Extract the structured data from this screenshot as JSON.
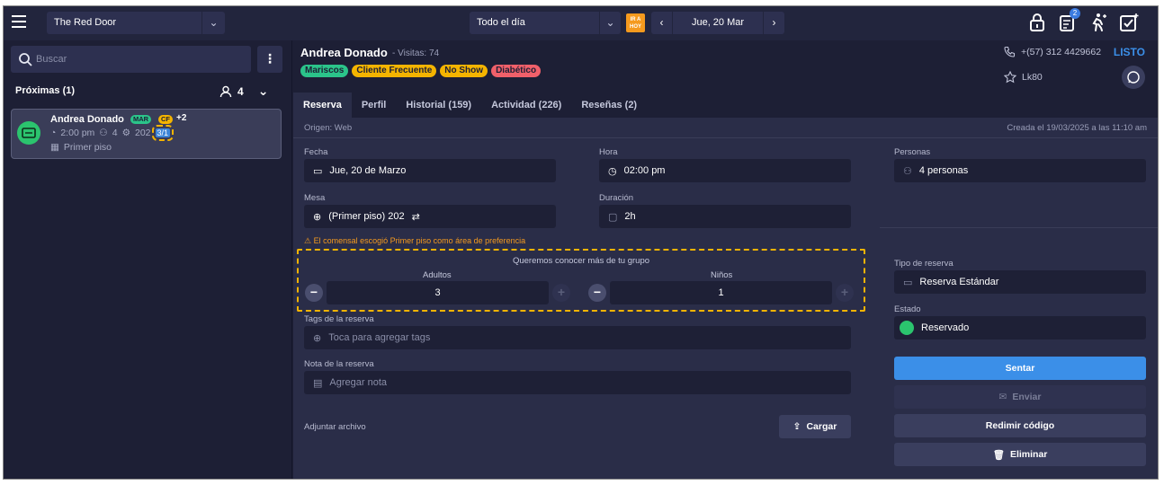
{
  "topbar": {
    "venue": "The Red Door",
    "shift": "Todo el día",
    "go_today": "IR A HOY",
    "date": "Jue, 20 Mar",
    "notification_count": "2"
  },
  "sidebar": {
    "search_placeholder": "Buscar",
    "section_title": "Próximas (1)",
    "section_covers": "4",
    "reservation": {
      "name": "Andrea Donado",
      "tag1": "MAR",
      "tag2": "CF",
      "more_tags": "+2",
      "time": "2:00 pm",
      "covers": "4",
      "table": "202",
      "count": "3/1",
      "area": "Primer piso"
    }
  },
  "guest": {
    "name": "Andrea Donado",
    "visits": "- Visitas: 74",
    "tags": [
      {
        "label": "Mariscos",
        "color": "#2bc48a"
      },
      {
        "label": "Cliente Frecuente",
        "color": "#f4b400"
      },
      {
        "label": "No Show",
        "color": "#f4b400"
      },
      {
        "label": "Diabético",
        "color": "#f0606a"
      }
    ],
    "phone": "+(57) 312 4429662",
    "status": "LISTO",
    "loyalty": "Lk80"
  },
  "tabs": [
    "Reserva",
    "Perfil",
    "Historial (159)",
    "Actividad (226)",
    "Reseñas (2)"
  ],
  "reservation": {
    "origin": "Origen: Web",
    "created": "Creada el 19/03/2025 a las 11:10 am",
    "date_label": "Fecha",
    "date_value": "Jue, 20 de Marzo",
    "time_label": "Hora",
    "time_value": "02:00 pm",
    "people_label": "Personas",
    "people_value": "4 personas",
    "table_label": "Mesa",
    "table_value": "(Primer piso) 202",
    "duration_label": "Duración",
    "duration_value": "2h",
    "warning": "⚠ El comensal escogió Primer piso como área de preferencia",
    "group_title": "Queremos conocer más de tu grupo",
    "adults_label": "Adultos",
    "adults_value": "3",
    "kids_label": "Niños",
    "kids_value": "1",
    "tags_label": "Tags de la reserva",
    "tags_placeholder": "Toca para agregar tags",
    "note_label": "Nota de la reserva",
    "note_placeholder": "Agregar nota",
    "attach_label": "Adjuntar archivo",
    "upload_button": "Cargar",
    "type_label": "Tipo de reserva",
    "type_value": "Reserva Estándar",
    "state_label": "Estado",
    "state_value": "Reservado"
  },
  "actions": {
    "seat": "Sentar",
    "send": "Enviar",
    "redeem": "Redimir código",
    "delete": "Eliminar"
  }
}
